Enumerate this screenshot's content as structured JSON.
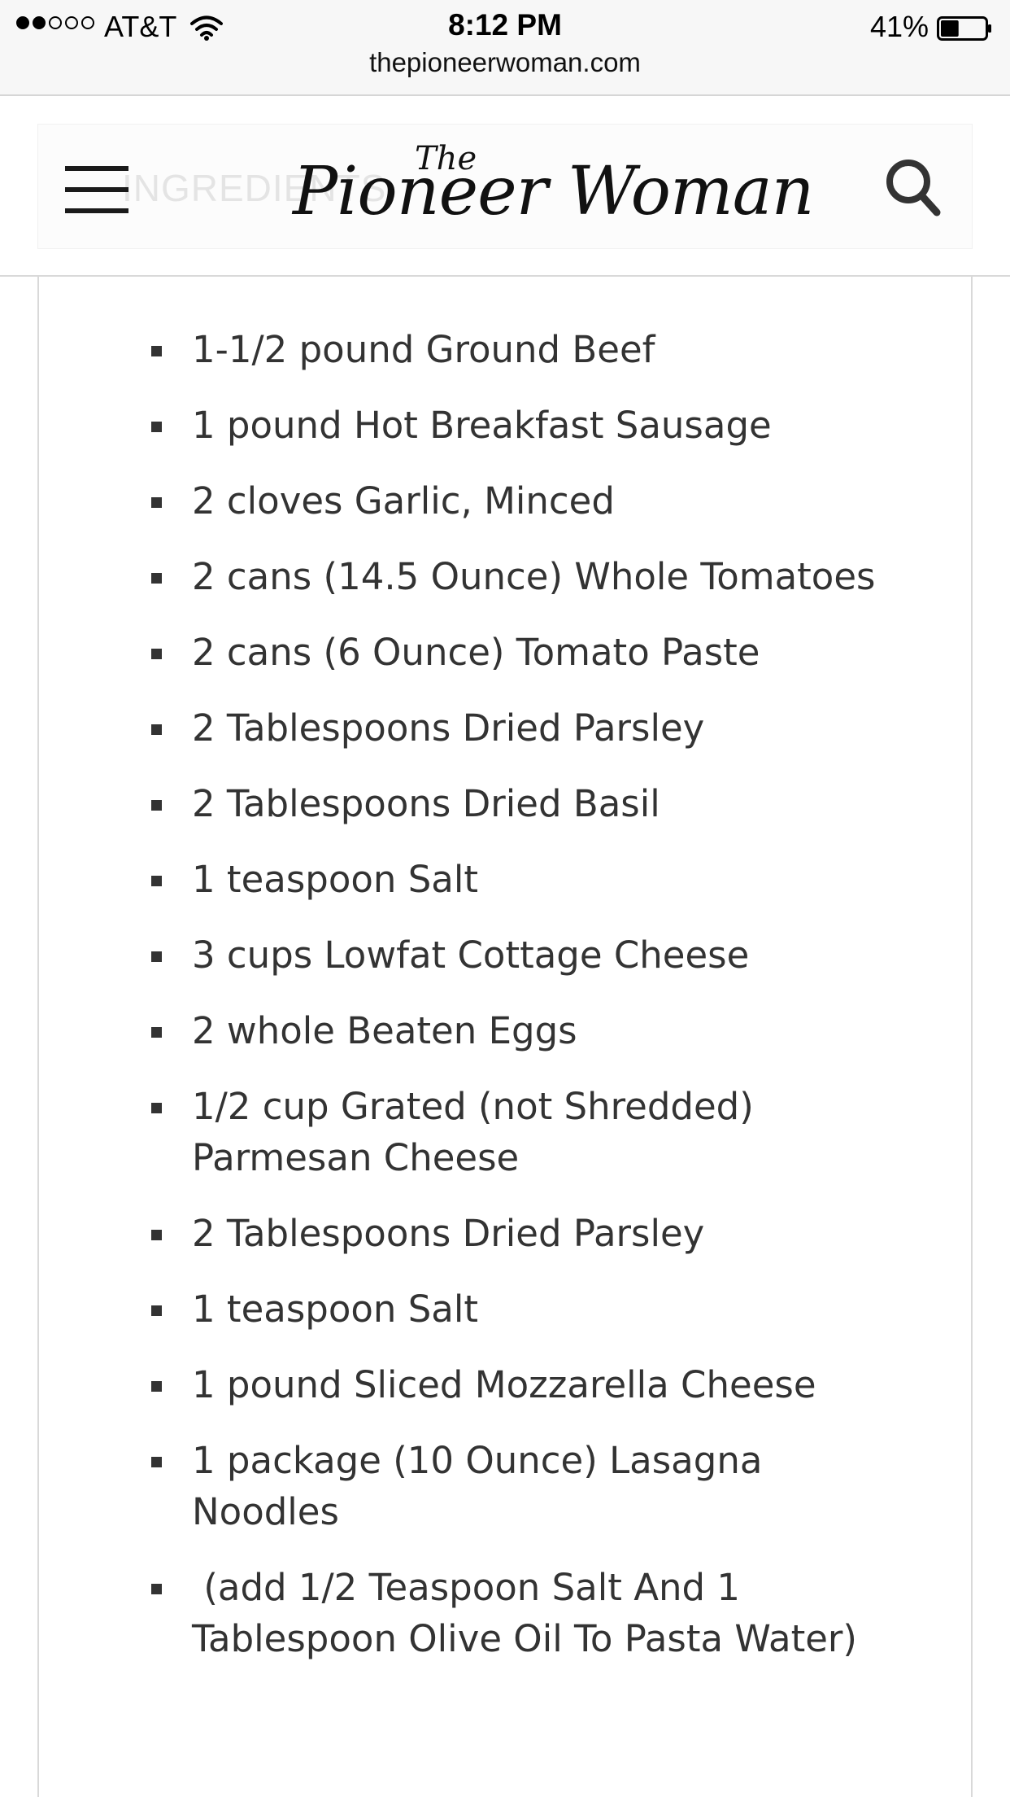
{
  "status_bar": {
    "carrier": "AT&T",
    "signal_bars_filled": 2,
    "signal_bars_total": 5,
    "time": "8:12 PM",
    "battery_percent": "41%",
    "battery_level": 0.41,
    "url": "thepioneerwoman.com"
  },
  "header": {
    "faded_section_label": "INGREDIENTS",
    "logo_the": "The",
    "logo_text": "Pioneer Woman"
  },
  "ingredients": [
    "1-1/2 pound Ground Beef",
    "1 pound Hot Breakfast Sausage",
    "2 cloves Garlic, Minced",
    "2 cans (14.5 Ounce) Whole Tomatoes",
    "2 cans (6 Ounce) Tomato Paste",
    "2 Tablespoons Dried Parsley",
    "2 Tablespoons Dried Basil",
    "1 teaspoon Salt",
    "3 cups Lowfat Cottage Cheese",
    "2 whole Beaten Eggs",
    "1/2 cup Grated (not Shredded) Parmesan Cheese",
    "2 Tablespoons Dried Parsley",
    "1 teaspoon Salt",
    "1 pound Sliced Mozzarella Cheese",
    "1 package (10 Ounce) Lasagna Noodles",
    " (add 1/2 Teaspoon Salt And 1 Tablespoon Olive Oil To Pasta Water)"
  ]
}
